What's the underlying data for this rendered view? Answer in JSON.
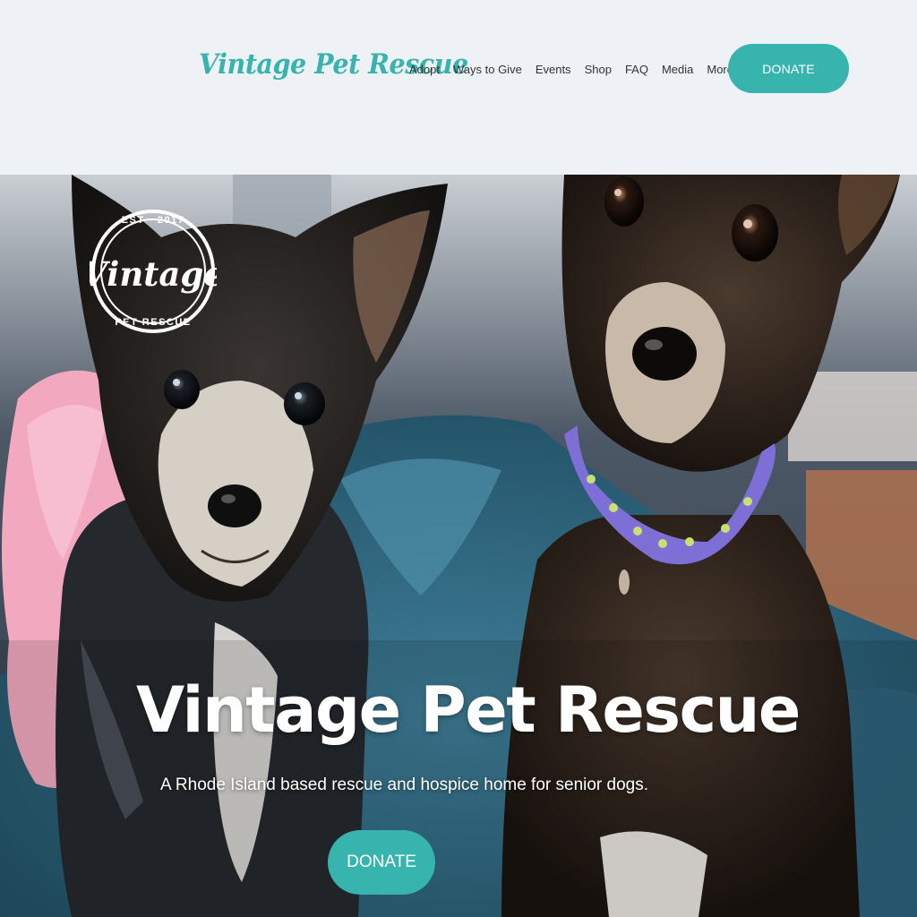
{
  "header": {
    "logo": "Vintage Pet Rescue",
    "nav": [
      "Adopt",
      "Ways to Give",
      "Events",
      "Shop",
      "FAQ",
      "Media",
      "More"
    ],
    "donate_label": "DONATE"
  },
  "hero": {
    "badge": {
      "est": "EST · 2017",
      "script": "Vintage",
      "bottom": "PET RESCUE"
    },
    "title": "Vintage Pet Rescue",
    "subtitle": "A Rhode Island based rescue and hospice home for senior dogs.",
    "donate_label": "DONATE"
  },
  "colors": {
    "accent": "#36b4ad",
    "header_bg": "#eef1f5"
  }
}
